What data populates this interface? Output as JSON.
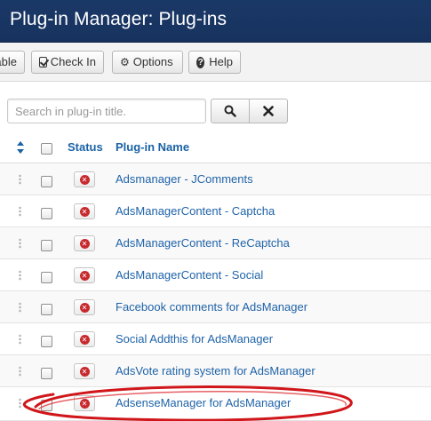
{
  "header": {
    "title": "Plug-in Manager: Plug-ins"
  },
  "toolbar": {
    "buttons": [
      {
        "label": "able",
        "icon": ""
      },
      {
        "label": "Check In",
        "icon": "checkbox-icon"
      },
      {
        "label": "Options",
        "icon": "gear-icon"
      },
      {
        "label": "Help",
        "icon": "help-icon"
      }
    ]
  },
  "search": {
    "placeholder": "Search in plug-in title.",
    "value": "",
    "search_icon": "search-icon",
    "clear_icon": "clear-icon"
  },
  "table": {
    "columns": {
      "status": "Status",
      "name": "Plug-in Name"
    },
    "rows": [
      {
        "name": "Adsmanager - JComments",
        "status": "disabled"
      },
      {
        "name": "AdsManagerContent - Captcha",
        "status": "disabled"
      },
      {
        "name": "AdsManagerContent - ReCaptcha",
        "status": "disabled"
      },
      {
        "name": "AdsManagerContent - Social",
        "status": "disabled"
      },
      {
        "name": "Facebook comments for AdsManager",
        "status": "disabled"
      },
      {
        "name": "Social Addthis for AdsManager",
        "status": "disabled"
      },
      {
        "name": "AdsVote rating system for AdsManager",
        "status": "disabled"
      },
      {
        "name": "AdsenseManager for AdsManager",
        "status": "disabled"
      }
    ]
  },
  "colors": {
    "header_bg": "#17325e",
    "link": "#1f63a8",
    "status_disabled": "#c8292c",
    "highlight": "#d0161a"
  }
}
